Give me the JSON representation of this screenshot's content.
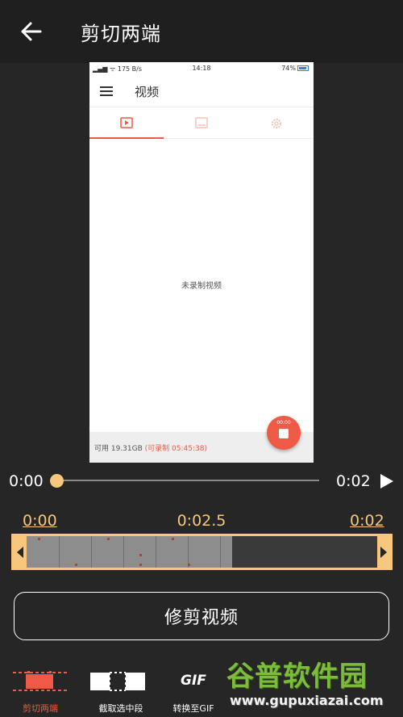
{
  "appbar": {
    "title": "剪切两端"
  },
  "preview": {
    "status": {
      "left": "175 B/s",
      "time": "14:18",
      "battery": "74%"
    },
    "title": "视频",
    "empty_text": "未录制视频",
    "free_label": "可用 19.31GB",
    "free_record": "(可录制 05:45:38)",
    "fab_time": "00:00"
  },
  "player": {
    "current": "0:00",
    "duration": "0:02",
    "progress": 0.0
  },
  "trim": {
    "start": "0:00",
    "mid": "0:02.5",
    "end": "0:02"
  },
  "trim_button": "修剪视频",
  "tools": [
    {
      "label": "剪切两端",
      "icon": "cut-ends-icon"
    },
    {
      "label": "截取选中段",
      "icon": "cut-middle-icon"
    },
    {
      "label": "转换至GIF",
      "icon": "gif-icon"
    }
  ],
  "gif_icon_text": "GIF",
  "watermark": {
    "name": "谷普软件园",
    "url": "www.gupuxiazai.com"
  },
  "colors": {
    "accent": "#ee5a46",
    "trim": "#f6c77c",
    "background": "#262626"
  }
}
